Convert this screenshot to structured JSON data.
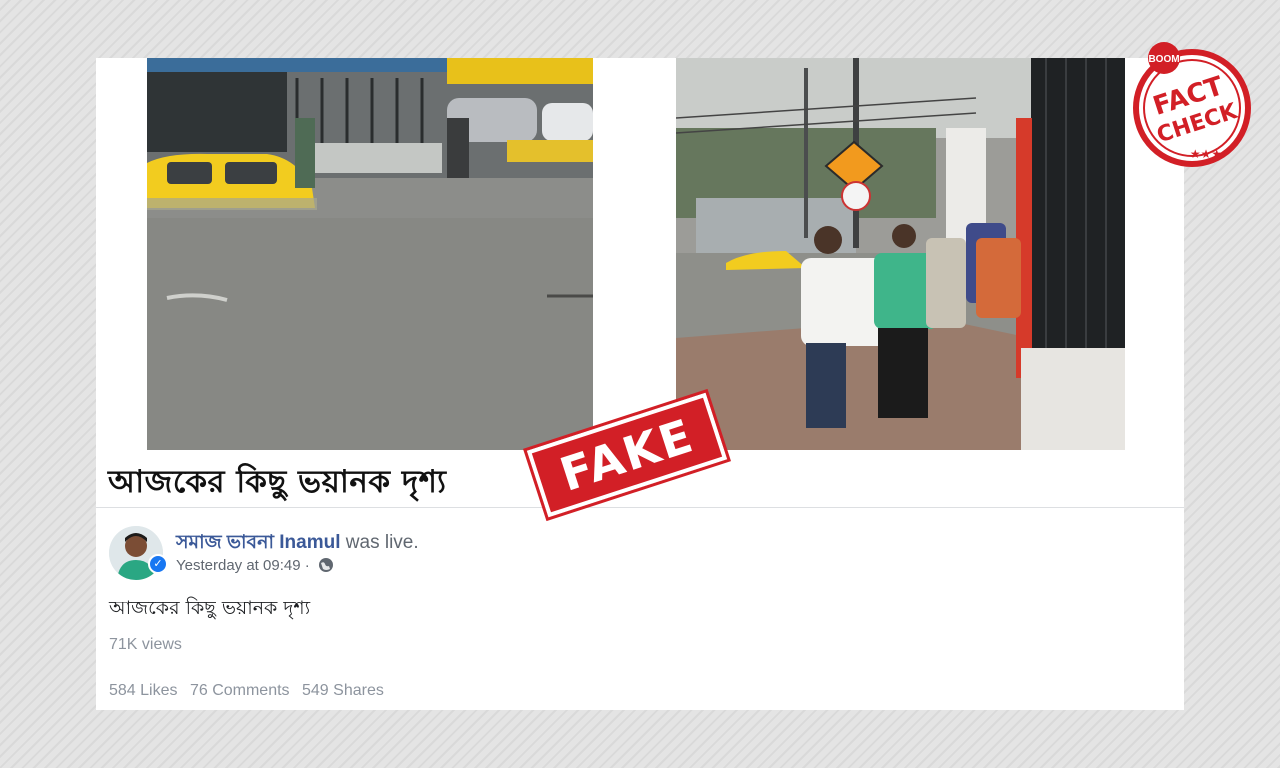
{
  "post": {
    "headline": "আজকের কিছু ভয়ানক দৃশ্য",
    "author": "সমাজ ভাবনা Inamul",
    "action": "was live.",
    "timestamp": "Yesterday at 09:49",
    "separator": "·",
    "text": "আজকের কিছু ভয়ানক দৃশ্য",
    "views": "71K views",
    "likes": "584 Likes",
    "comments": "76 Comments",
    "shares": "549 Shares"
  },
  "stamps": {
    "fake": "FAKE",
    "brand": "BOOM",
    "fact": "FACT",
    "check": "CHECK"
  },
  "colors": {
    "author_link": "#3b5998",
    "stamp_red": "#d21f26",
    "taxi_yellow": "#f2cc1f"
  },
  "icons": {
    "privacy": "globe-icon",
    "verified": "verified-badge-icon"
  }
}
